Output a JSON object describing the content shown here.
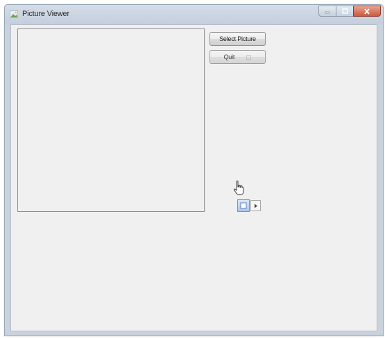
{
  "window": {
    "title": "Picture Viewer",
    "icon": "app-icon"
  },
  "caption_buttons": {
    "minimize_icon": "minimize-icon",
    "maximize_icon": "maximize-icon",
    "close_icon": "close-icon"
  },
  "buttons": {
    "select_picture": "Select Picture",
    "quit": "Quit"
  },
  "designer": {
    "smart_tag_icon": "smart-tag-icon",
    "smart_tag_arrow_icon": "chevron-right-icon",
    "cursor_icon": "hand-pointer-icon"
  },
  "colors": {
    "form_background": "#f0f0f0",
    "title_bar": "#c9d3de",
    "close_button": "#cc5a3c"
  }
}
